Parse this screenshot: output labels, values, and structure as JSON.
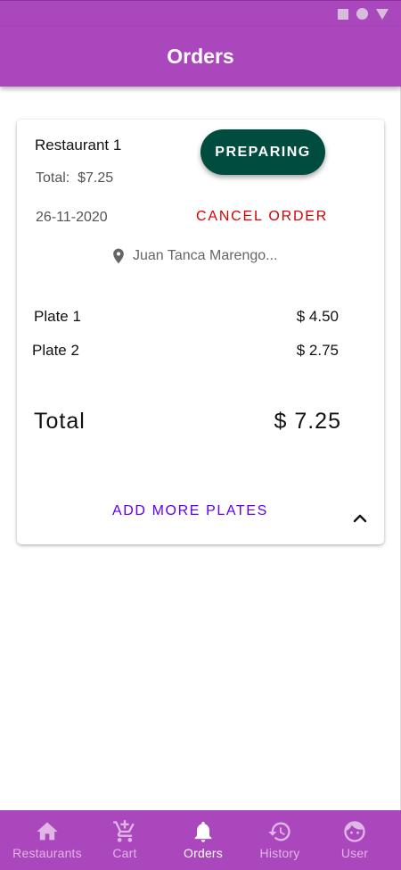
{
  "app_bar": {
    "title": "Orders"
  },
  "order": {
    "restaurant": "Restaurant 1",
    "total_summary": "Total:  $7.25",
    "date": "26-11-2020",
    "status": "PREPARING",
    "cancel_label": "CANCEL ORDER",
    "address": "Juan Tanca Marengo...",
    "items": [
      {
        "name": "Plate 1",
        "price": "$ 4.50"
      },
      {
        "name": "Plate 2",
        "price": "$ 2.75"
      }
    ],
    "grand_total_label": "Total",
    "grand_total_value": "$ 7.25",
    "add_more_label": "ADD MORE PLATES"
  },
  "nav": {
    "active": "Orders",
    "items": [
      {
        "label": "Restaurants",
        "icon": "home-icon"
      },
      {
        "label": "Cart",
        "icon": "add-shopping-cart-icon"
      },
      {
        "label": "Orders",
        "icon": "bell-icon"
      },
      {
        "label": "History",
        "icon": "history-icon"
      },
      {
        "label": "User",
        "icon": "face-icon"
      }
    ]
  },
  "colors": {
    "primary": "#ab47bc",
    "status_chip": "#004d40",
    "cancel": "#d50000",
    "accent": "#6200ea",
    "nav_inactive": "#e0b6e6",
    "nav_active": "#ffffff"
  }
}
